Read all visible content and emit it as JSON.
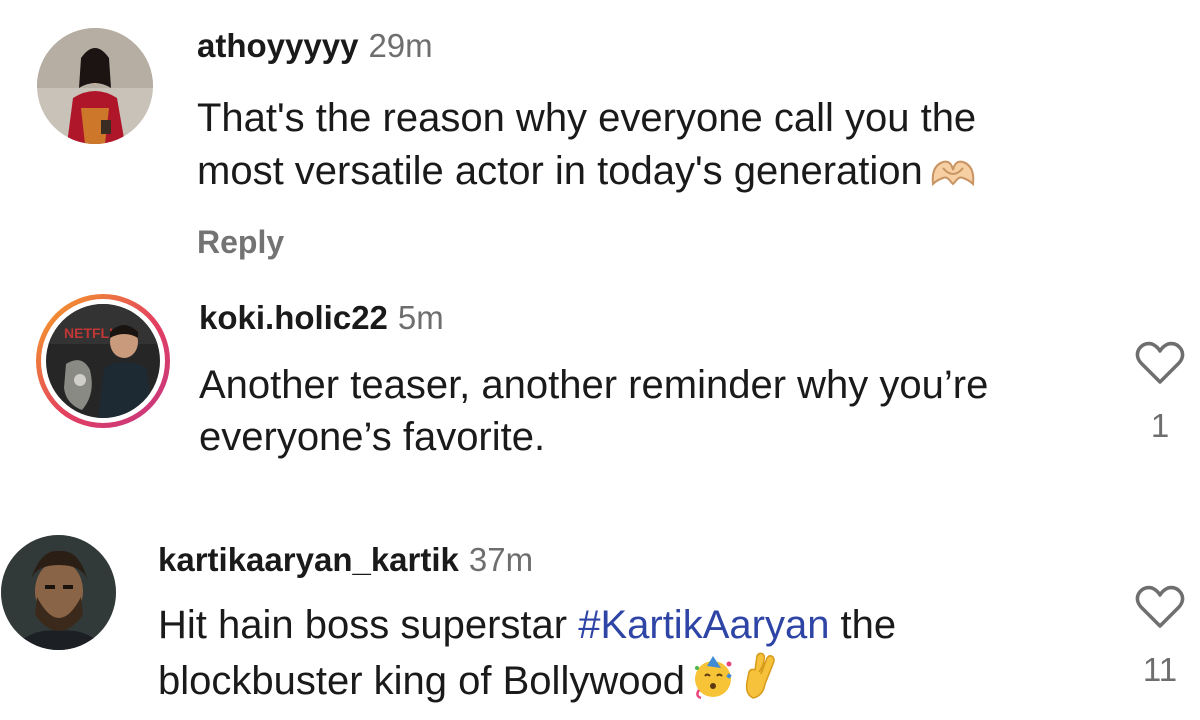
{
  "comments": [
    {
      "username": "athoyyyyy",
      "time": "29m",
      "line1": "That's the reason why everyone call you the",
      "line2": "most versatile actor in today's generation",
      "emoji": "heart-hands-icon",
      "reply_label": "Reply"
    },
    {
      "username": "koki.holic22",
      "time": "5m",
      "line1": "Another teaser, another reminder why you’re",
      "line2": "everyone’s favorite.",
      "avatar_badge": "NETFLIX",
      "like_count": "1"
    },
    {
      "username": "kartikaaryan_kartik",
      "time": "37m",
      "line1_pre": "Hit hain boss superstar ",
      "line1_hashtag": "#KartikAaryan",
      "line1_post": " the",
      "line2": "blockbuster king of Bollywood",
      "emojis": [
        "partying-face-icon",
        "crossed-fingers-icon"
      ],
      "like_count": "11"
    }
  ],
  "colors": {
    "hashtag": "#2e45a6",
    "muted": "#6e6e6e",
    "story_ring_start": "#f5a623",
    "story_ring_end": "#d62976"
  }
}
